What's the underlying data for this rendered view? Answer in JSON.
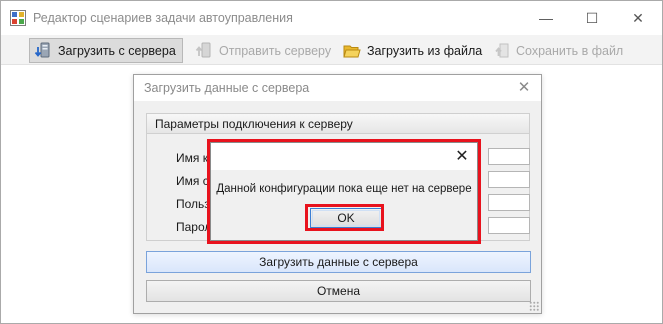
{
  "window": {
    "title": "Редактор сценариев задачи автоуправления",
    "minimize_glyph": "—",
    "maximize_glyph": "☐",
    "close_glyph": "✕",
    "icon": "app-window-icon"
  },
  "toolbar": {
    "items": [
      {
        "label": "Загрузить с сервера",
        "icon": "server-download-icon",
        "state": "active"
      },
      {
        "label": "Отправить серверу",
        "icon": "server-upload-icon",
        "state": "disabled"
      },
      {
        "label": "Загрузить из файла",
        "icon": "folder-open-icon",
        "state": "enabled"
      },
      {
        "label": "Сохранить в файл",
        "icon": "save-file-icon",
        "state": "disabled"
      }
    ]
  },
  "load_dialog": {
    "title": "Загрузить данные с сервера",
    "close_glyph": "✕",
    "group_title": "Параметры подключения к  серверу",
    "fields": [
      {
        "label": "Имя ко"
      },
      {
        "label": "Имя се"
      },
      {
        "label": "Польз"
      },
      {
        "label": "Парол"
      }
    ],
    "load_button": "Загрузить данные с сервера",
    "cancel_button": "Отмена"
  },
  "message_box": {
    "close_glyph": "✕",
    "text": "Данной конфигурации пока еще нет на сервере",
    "ok_button": "OK"
  },
  "colors": {
    "highlight": "#e8121d",
    "focus_border": "#3c7fd3",
    "dialog_bg": "#f0f0f0"
  }
}
